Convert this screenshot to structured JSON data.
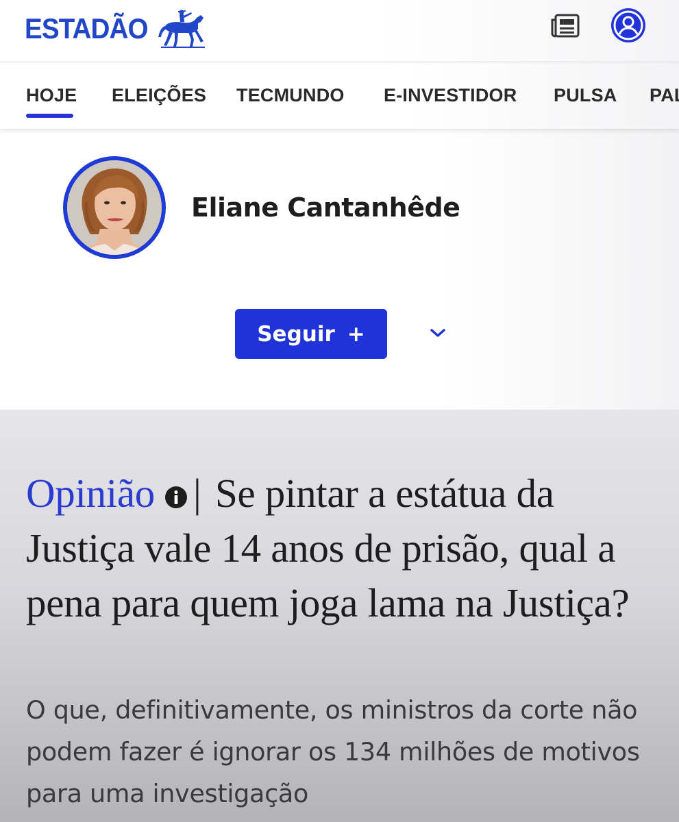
{
  "header": {
    "logo_text": "ESTADÃO",
    "brand_color": "#2147c8",
    "icons": [
      "horse-rider-logo",
      "newspaper-icon",
      "user-account-icon"
    ]
  },
  "nav": {
    "items": [
      {
        "label": "HOJE",
        "active": true
      },
      {
        "label": "ELEIÇÕES",
        "active": false
      },
      {
        "label": "TECMUNDO",
        "active": false
      },
      {
        "label": "E-INVESTIDOR",
        "active": false
      },
      {
        "label": "PULSA",
        "active": false
      },
      {
        "label": "PAL",
        "active": false
      }
    ],
    "active_color": "#2434d6"
  },
  "author": {
    "name": "Eliane Cantanhêde",
    "follow_label": "Seguir",
    "follow_icon": "+",
    "accent_color": "#1f33d8"
  },
  "article": {
    "section": "Opinião",
    "separator": "|",
    "title": "Se pintar a estátua da Justiça vale 14 anos de prisão, qual a pena para quem joga lama na Justiça?",
    "subtitle": "O que, definitivamente, os ministros da corte não podem fazer é ignorar os 134 milhões de motivos para uma investigação"
  }
}
